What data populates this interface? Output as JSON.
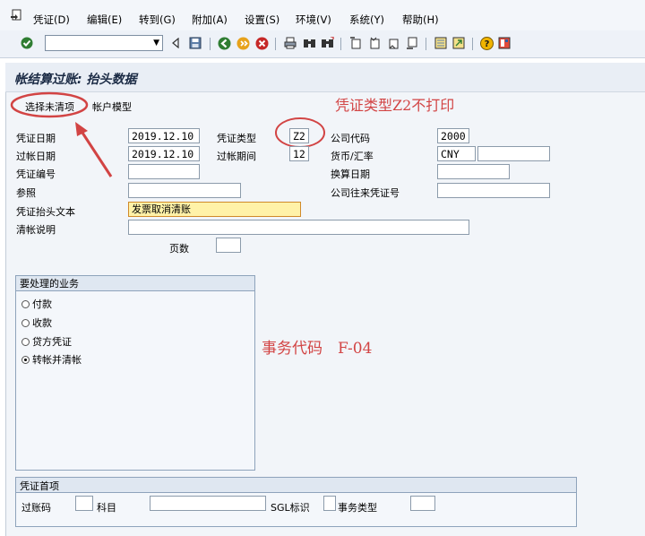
{
  "menu": {
    "items": [
      {
        "label": "凭证(D)"
      },
      {
        "label": "编辑(E)"
      },
      {
        "label": "转到(G)"
      },
      {
        "label": "附加(A)"
      },
      {
        "label": "设置(S)"
      },
      {
        "label": "环境(V)"
      },
      {
        "label": "系统(Y)"
      },
      {
        "label": "帮助(H)"
      }
    ]
  },
  "toolbar": {
    "command_field_value": ""
  },
  "page": {
    "title": "帐结算过账: 抬头数据"
  },
  "tabs": {
    "select_open_items": "选择未清项",
    "account_model": "帐户模型"
  },
  "annotations": {
    "note1": "凭证类型Z2不打印",
    "note2": "事务代码　F-04"
  },
  "header": {
    "doc_date_label": "凭证日期",
    "doc_date_value": "2019.12.10",
    "doc_type_label": "凭证类型",
    "doc_type_value": "Z2",
    "company_code_label": "公司代码",
    "company_code_value": "2000",
    "posting_date_label": "过帐日期",
    "posting_date_value": "2019.12.10",
    "period_label": "过帐期间",
    "period_value": "12",
    "currency_label": "货币/汇率",
    "currency_value": "CNY",
    "exchange_rate_value": "",
    "doc_number_label": "凭证编号",
    "doc_number_value": "",
    "translation_date_label": "换算日期",
    "translation_date_value": "",
    "reference_label": "参照",
    "reference_value": "",
    "intercompany_label": "公司往来凭证号",
    "intercompany_value": "",
    "header_text_label": "凭证抬头文本",
    "header_text_value": "发票取消清账",
    "clearing_text_label": "清帐说明",
    "clearing_text_value": "",
    "pages_label": "页数",
    "pages_value": ""
  },
  "transaction_group": {
    "title": "要处理的业务",
    "options": [
      {
        "label": "付款",
        "selected": false
      },
      {
        "label": "收款",
        "selected": false
      },
      {
        "label": "贷方凭证",
        "selected": false
      },
      {
        "label": "转帐并清帐",
        "selected": true
      }
    ]
  },
  "first_line_item": {
    "title": "凭证首项",
    "posting_key_label": "过账码",
    "posting_key_value": "",
    "account_label": "科目",
    "account_value": "",
    "sgl_label": "SGL标识",
    "sgl_value": "",
    "transaction_type_label": "事务类型",
    "transaction_type_value": ""
  },
  "colors": {
    "annotation_red": "#d24444",
    "highlight_yellow": "#fff2a8",
    "panel_bg": "#f2f5f9"
  }
}
